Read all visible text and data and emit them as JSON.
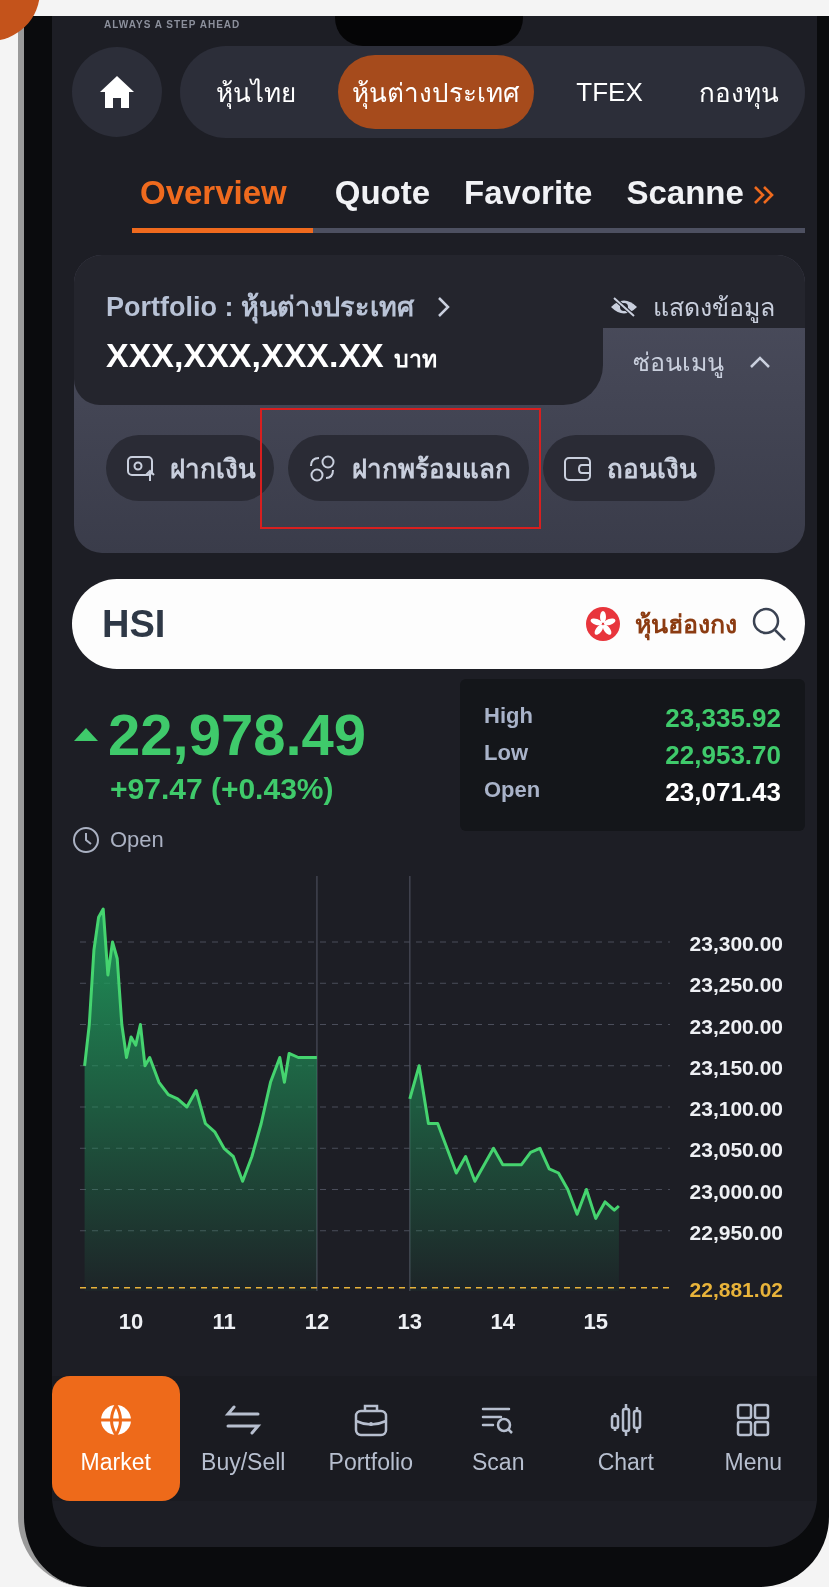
{
  "header": {
    "tagline": "ALWAYS A STEP AHEAD"
  },
  "market_tabs": [
    {
      "label": "หุ้นไทย",
      "selected": false
    },
    {
      "label": "หุ้นต่างประเทศ",
      "selected": true
    },
    {
      "label": "TFEX",
      "selected": false
    },
    {
      "label": "กองทุน",
      "selected": false
    }
  ],
  "sub_tabs": [
    {
      "label": "Overview",
      "selected": true
    },
    {
      "label": "Quote",
      "selected": false
    },
    {
      "label": "Favorite",
      "selected": false
    },
    {
      "label": "Scanne",
      "selected": false
    }
  ],
  "portfolio": {
    "title": "Portfolio : หุ้นต่างประเทศ",
    "show_data": "แสดงข้อมูล",
    "value": "XXX,XXX,XXX.XX",
    "currency": "บาท",
    "menu_toggle": {
      "label": "ซ่อนเมนู",
      "expanded": true
    },
    "actions": [
      {
        "kind": "deposit",
        "label": "ฝากเงิน",
        "highlighted": false
      },
      {
        "kind": "exchange",
        "label": "ฝากพร้อมแลก",
        "highlighted": true
      },
      {
        "kind": "withdraw",
        "label": "ถอนเงิน",
        "highlighted": false
      }
    ]
  },
  "search": {
    "value": "HSI",
    "market": "หุ้นฮ่องกง"
  },
  "quote": {
    "rising": true,
    "color": "#3fca6b",
    "price": "22,978.49",
    "change": "+97.47 (+0.43%)",
    "session": "Open",
    "stats": [
      {
        "label": "High",
        "value": "23,335.92",
        "color": "#3fca6b"
      },
      {
        "label": "Low",
        "value": "22,953.70",
        "color": "#3fca6b"
      },
      {
        "label": "Open",
        "value": "23,071.43",
        "color": "#ffffff"
      }
    ]
  },
  "chart": {
    "chart_data": {
      "type": "area",
      "x": [
        9.5,
        9.55,
        9.6,
        9.65,
        9.7,
        9.75,
        9.8,
        9.85,
        9.9,
        9.95,
        10.0,
        10.05,
        10.1,
        10.15,
        10.2,
        10.3,
        10.4,
        10.5,
        10.6,
        10.7,
        10.8,
        10.9,
        11.0,
        11.1,
        11.2,
        11.3,
        11.4,
        11.5,
        11.6,
        11.65,
        11.7,
        11.8,
        12.0,
        12.5,
        13.0,
        13.1,
        13.2,
        13.3,
        13.4,
        13.5,
        13.6,
        13.7,
        13.8,
        13.9,
        14.0,
        14.1,
        14.2,
        14.3,
        14.4,
        14.5,
        14.6,
        14.7,
        14.8,
        14.9,
        15.0,
        15.1,
        15.2,
        15.25
      ],
      "series": [
        {
          "color": "#45d46f",
          "values": [
            23150,
            23200,
            23290,
            23330,
            23340,
            23260,
            23300,
            23280,
            23200,
            23160,
            23185,
            23175,
            23200,
            23150,
            23160,
            23130,
            23115,
            23110,
            23100,
            23120,
            23080,
            23070,
            23050,
            23040,
            23010,
            23040,
            23080,
            23130,
            23160,
            23130,
            23165,
            23160,
            23160,
            null,
            23110,
            23150,
            23080,
            23080,
            23050,
            23020,
            23040,
            23010,
            23030,
            23050,
            23030,
            23030,
            23030,
            23045,
            23050,
            23025,
            23020,
            23000,
            22970,
            23000,
            22965,
            22985,
            22975,
            22980
          ]
        }
      ],
      "xlim": [
        9.45,
        15.8
      ],
      "ylim": [
        22877,
        23380
      ],
      "grid": true,
      "xticks": [
        10,
        11,
        12,
        13,
        14,
        15
      ],
      "yticks": [
        {
          "value": 22950,
          "label": "22,950.00"
        },
        {
          "value": 23000,
          "label": "23,000.00"
        },
        {
          "value": 23050,
          "label": "23,050.00"
        },
        {
          "value": 23100,
          "label": "23,100.00"
        },
        {
          "value": 23150,
          "label": "23,150.00"
        },
        {
          "value": 23200,
          "label": "23,200.00"
        },
        {
          "value": 23250,
          "label": "23,250.00"
        },
        {
          "value": 23300,
          "label": "23,300.00"
        }
      ],
      "ref_lines": [
        {
          "axis": "y",
          "value": 22881.02,
          "label": "22,881.02",
          "color": "#e8b33a"
        }
      ]
    }
  },
  "bottom_nav": [
    {
      "kind": "market",
      "label": "Market",
      "selected": true
    },
    {
      "kind": "trade",
      "label": "Buy/Sell",
      "selected": false
    },
    {
      "kind": "portfolio",
      "label": "Portfolio",
      "selected": false
    },
    {
      "kind": "scan",
      "label": "Scan",
      "selected": false
    },
    {
      "kind": "chart",
      "label": "Chart",
      "selected": false
    },
    {
      "kind": "menu",
      "label": "Menu",
      "selected": false
    }
  ]
}
